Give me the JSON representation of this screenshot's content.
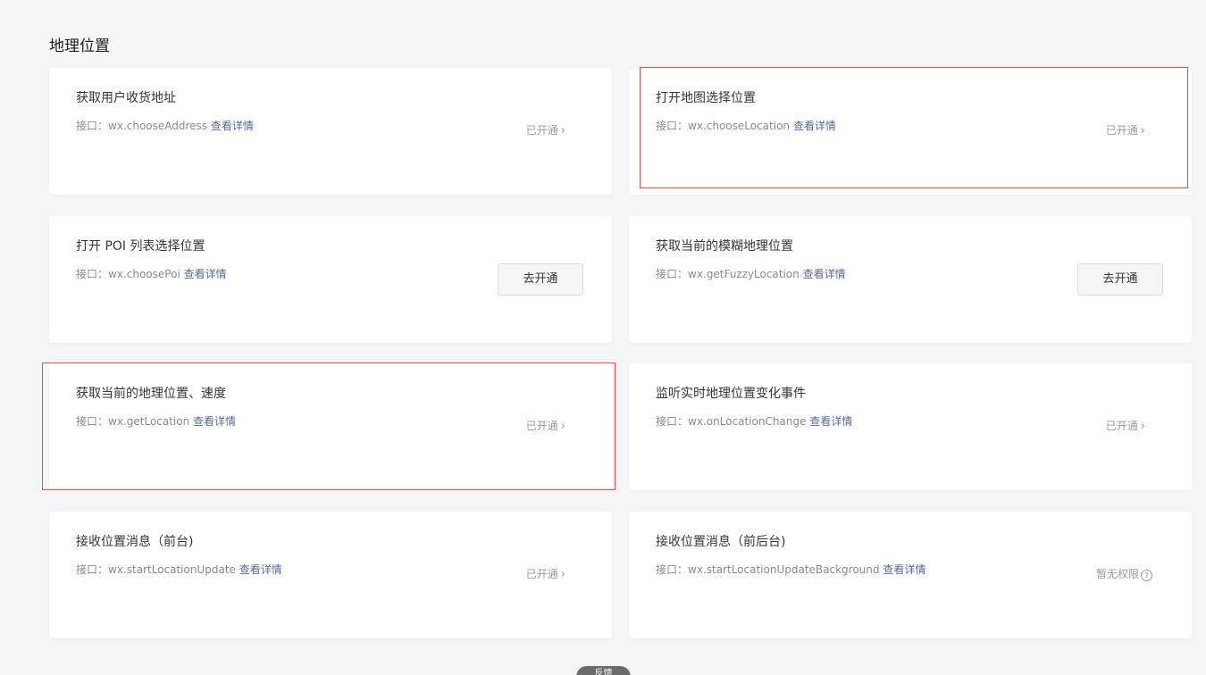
{
  "section": {
    "title": "地理位置"
  },
  "cards": [
    {
      "title": "获取用户收货地址",
      "api_prefix": "接口：",
      "api": "wx.chooseAddress",
      "detail": "查看详情",
      "status": "已开通"
    },
    {
      "title": "打开地图选择位置",
      "api_prefix": "接口：",
      "api": "wx.chooseLocation",
      "detail": "查看详情",
      "status": "已开通"
    },
    {
      "title": "打开 POI 列表选择位置",
      "api_prefix": "接口：",
      "api": "wx.choosePoi",
      "detail": "查看详情",
      "button": "去开通"
    },
    {
      "title": "获取当前的模糊地理位置",
      "api_prefix": "接口：",
      "api": "wx.getFuzzyLocation",
      "detail": "查看详情",
      "button": "去开通"
    },
    {
      "title": "获取当前的地理位置、速度",
      "api_prefix": "接口：",
      "api": "wx.getLocation",
      "detail": "查看详情",
      "status": "已开通"
    },
    {
      "title": "监听实时地理位置变化事件",
      "api_prefix": "接口：",
      "api": "wx.onLocationChange",
      "detail": "查看详情",
      "status": "已开通"
    },
    {
      "title": "接收位置消息（前台)",
      "api_prefix": "接口：",
      "api": "wx.startLocationUpdate",
      "detail": "查看详情",
      "status": "已开通"
    },
    {
      "title": "接收位置消息（前后台)",
      "api_prefix": "接口：",
      "api": "wx.startLocationUpdateBackground",
      "detail": "查看详情",
      "status": "暂无权限"
    }
  ],
  "icons": {
    "chevron": "chevron-right-icon",
    "help": "question-circle-icon"
  },
  "colors": {
    "link": "#576b95",
    "highlight": "#e8494b",
    "background": "#f4f5f7"
  },
  "floating": {
    "label": "反馈"
  }
}
